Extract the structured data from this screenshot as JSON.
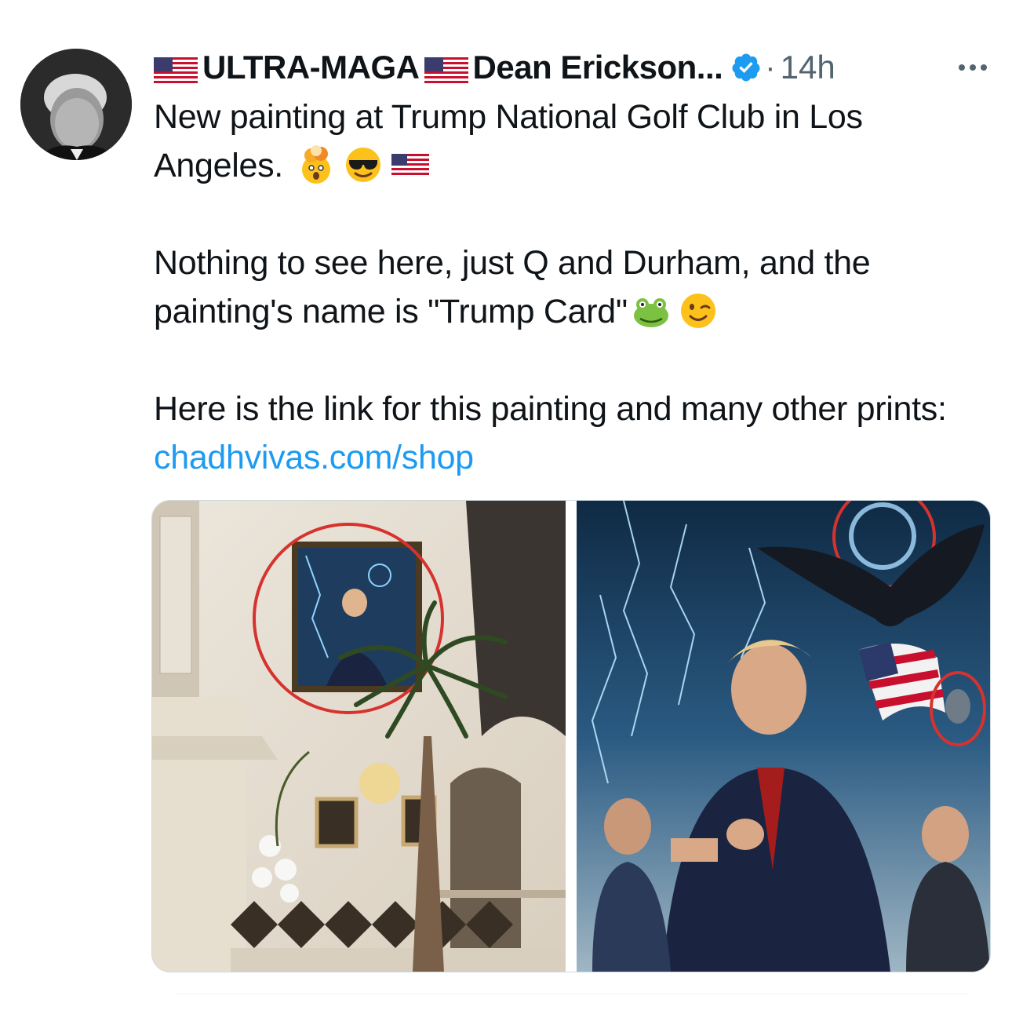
{
  "tweet": {
    "author_prefix": "ULTRA-MAGA",
    "author_name": "Dean Erickson...",
    "verified": true,
    "separator": "·",
    "time": "14h",
    "text_line1": "New painting at Trump National Golf Club in Los Angeles.",
    "text_line2": "Nothing to see here, just Q and Durham, and the painting's name is \"Trump Card\"",
    "text_line3_prefix": "Here is the link for this painting and many other prints: ",
    "link_text": "chadhvivas.com/shop"
  },
  "icons": {
    "flag": "us-flag-icon",
    "verified": "verified-badge-icon",
    "more": "more-options-icon",
    "emojis_line1": [
      "exploding-head-emoji",
      "sunglasses-emoji",
      "us-flag-emoji"
    ],
    "emojis_line2": [
      "frog-emoji",
      "winking-emoji"
    ]
  },
  "colors": {
    "text": "#0f1419",
    "secondary": "#536471",
    "link": "#1d9bf0",
    "verified": "#1d9bf0"
  }
}
